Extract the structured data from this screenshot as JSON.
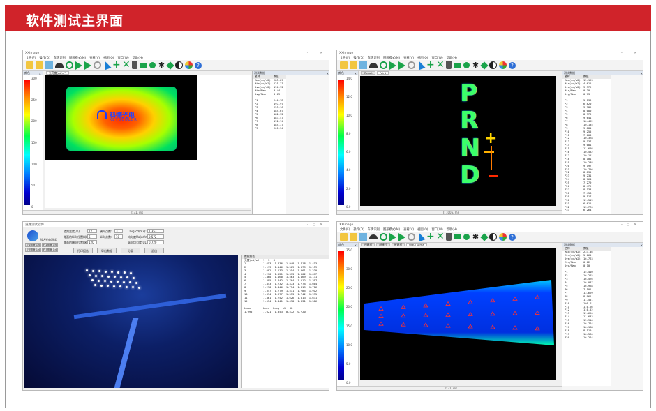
{
  "header": {
    "title": "软件测试主界面"
  },
  "app": {
    "menu": [
      "文件(F)",
      "操作(O)",
      "车牌识别",
      "图形模式(M)",
      "查看(V)",
      "视图(Q)",
      "窗口(W)",
      "帮助(H)"
    ]
  },
  "panel_left_header": "颜色",
  "panel_right_header": "测试数据",
  "tl": {
    "title": "XXImage",
    "tab": "光亮度(cd/m²)",
    "scale": [
      "300",
      "250",
      "200",
      "150",
      "100",
      "50",
      "0"
    ],
    "logo_text": "科德光电",
    "logo_sub": "KEYDCOLOR",
    "status": "T: 31, ms",
    "table_head": [
      "名称",
      "数值"
    ],
    "table_summary": [
      [
        "Max(cd/m2)",
        "285.87"
      ],
      [
        "Min(cd/m2)",
        "125.33"
      ],
      [
        "Ave(cd/m2)",
        "196.92"
      ],
      [
        "Min/Max",
        "0.44"
      ],
      [
        "Avg/Max",
        "0.69"
      ]
    ],
    "table_points": [
      [
        "P1",
        "246.78"
      ],
      [
        "P2",
        "197.97"
      ],
      [
        "P3",
        "255.16"
      ],
      [
        "P4",
        "185.67"
      ],
      [
        "P5",
        "182.32"
      ],
      [
        "P6",
        "183.47"
      ],
      [
        "P7",
        "192.74"
      ],
      [
        "P8",
        "185.37"
      ],
      [
        "P9",
        "201.34"
      ]
    ]
  },
  "tr": {
    "title": "XXImage",
    "tabs": [
      "Result",
      "Point"
    ],
    "scale": [
      "14.0",
      "12.0",
      "10.0",
      "8.0",
      "6.0",
      "4.0",
      "2.0",
      "0.0"
    ],
    "gear_letters": [
      "P",
      "R",
      "N",
      "D"
    ],
    "status": "T: 1005, ms",
    "table_head": [
      "名称",
      "数值"
    ],
    "table_summary": [
      [
        "Max(cd/m2)",
        "15.123"
      ],
      [
        "Min(cd/m2)",
        "4.612"
      ],
      [
        "Ave(cd/m2)",
        "9.372"
      ],
      [
        "Min/Max",
        "0.30"
      ],
      [
        "Avg/Max",
        "0.73"
      ]
    ],
    "table_points": [
      [
        "P1",
        "5.139"
      ],
      [
        "P2",
        "6.820"
      ],
      [
        "P3",
        "9.982"
      ],
      [
        "P4",
        "8.080"
      ],
      [
        "P5",
        "8.979"
      ],
      [
        "P6",
        "9.641"
      ],
      [
        "P7",
        "10.492"
      ],
      [
        "P8",
        "10.135"
      ],
      [
        "P9",
        "9.881"
      ],
      [
        "P10",
        "9.255"
      ],
      [
        "P11",
        "7.600"
      ],
      [
        "P12",
        "10.378"
      ],
      [
        "P13",
        "9.137"
      ],
      [
        "P14",
        "9.081"
      ],
      [
        "P15",
        "11.608"
      ],
      [
        "P16",
        "10.582"
      ],
      [
        "P17",
        "10.151"
      ],
      [
        "P18",
        "8.101"
      ],
      [
        "P19",
        "10.238"
      ],
      [
        "P20",
        "9.197"
      ],
      [
        "P21",
        "10.756"
      ],
      [
        "P22",
        "8.835"
      ],
      [
        "P23",
        "9.231"
      ],
      [
        "P24",
        "8.764"
      ],
      [
        "P25",
        "7.279"
      ],
      [
        "P26",
        "8.472"
      ],
      [
        "P27",
        "8.133"
      ],
      [
        "P28",
        "7.458"
      ],
      [
        "P29",
        "9.517"
      ],
      [
        "P30",
        "11.519"
      ],
      [
        "P31",
        "6.612"
      ],
      [
        "P32",
        "13.776"
      ],
      [
        "P33",
        "6.264"
      ]
    ]
  },
  "bl": {
    "title": "道路测试软件",
    "logo_caption": "科达光电测试",
    "left_buttons": [
      "左1照度 1:6",
      "右1照度 1:6",
      "左7照度 1:6",
      "右7照度 1:6"
    ],
    "fields": [
      {
        "label": "道路宽度(米):",
        "value": "12"
      },
      {
        "label": "路面的纵向位置(米):",
        "value": "6"
      },
      {
        "label": "路面的横向位置(米):",
        "value": "120"
      }
    ],
    "fields2": [
      {
        "label": "横向点数:",
        "value": "3"
      },
      {
        "label": "纵向点数:",
        "value": "10"
      }
    ],
    "fields3": [
      {
        "label": "Lavg(cd/m2):",
        "value": "1.353"
      },
      {
        "label": "均匀度Uo(cd/m2):",
        "value": "0.572"
      },
      {
        "label": "纵向均匀度(UL):",
        "value": "0.720"
      }
    ],
    "buttons": [
      "打印报告",
      "导出数据",
      "分屏",
      "退出"
    ],
    "table_title": "数据报告",
    "table_head": [
      "亮度(cd/m2)",
      "1",
      "2",
      "3"
    ],
    "table_rows": [
      [
        "1",
        "1.653",
        "1.436",
        "1.948",
        "1.718",
        "1.413"
      ],
      [
        "2",
        "1.119",
        "1.146",
        "1.509",
        "1.079",
        "1.159"
      ],
      [
        "3",
        "1.082",
        "1.133",
        "1.254",
        "1.061",
        "1.230"
      ],
      [
        "4",
        "1.270",
        "1.021",
        "1.313",
        "1.002",
        "1.077"
      ],
      [
        "5",
        "1.460",
        "1.160",
        "1.563",
        "1.469",
        "1.131"
      ],
      [
        "6",
        "1.395",
        "1.442",
        "1.704",
        "1.512",
        "1.397"
      ],
      [
        "7",
        "1.443",
        "1.732",
        "1.473",
        "1.774",
        "1.604"
      ],
      [
        "8",
        "1.290",
        "1.446",
        "1.754",
        "1.319",
        "1.716"
      ],
      [
        "9",
        "1.347",
        "1.779",
        "1.511",
        "1.785",
        "1.912"
      ],
      [
        "10",
        "1.394",
        "1.677",
        "1.553",
        "1.742",
        "1.995"
      ],
      [
        "11",
        "1.461",
        "1.752",
        "1.626",
        "1.513",
        "1.631"
      ],
      [
        "12",
        "1.554",
        "1.441",
        "1.698",
        "1.331",
        "1.586"
      ]
    ],
    "summary_head": [
      "Lmax",
      "Lmin",
      "Lavg",
      "U0",
      "UL"
    ],
    "summary_vals": [
      "1.995",
      "1.021",
      "1.353",
      "0.572",
      "0.720"
    ]
  },
  "br": {
    "title": "XXImage",
    "tabs": [
      "所建打",
      "所建打",
      "所建打",
      "Ortul Koma"
    ],
    "scale": [
      "35.0",
      "30.0",
      "25.0",
      "20.0",
      "15.0",
      "10.0",
      "5.0",
      "0.0"
    ],
    "status": "T: 31, ms",
    "table_head": [
      "名称",
      "数值"
    ],
    "table_summary": [
      [
        "Max(cd/m2)",
        "233.46"
      ],
      [
        "Min(cd/m2)",
        "5.665"
      ],
      [
        "Ave(cd/m2)",
        "16.763"
      ],
      [
        "Min/Max",
        "0.02"
      ],
      [
        "Avg/Max",
        "0.10"
      ]
    ],
    "table_points": [
      [
        "P1",
        "15.410"
      ],
      [
        "P2",
        "16.202"
      ],
      [
        "P3",
        "16.576"
      ],
      [
        "P4",
        "16.087"
      ],
      [
        "P5",
        "16.928"
      ],
      [
        "P6",
        "7.501"
      ],
      [
        "P7",
        "13.669"
      ],
      [
        "P8",
        "8.961"
      ],
      [
        "P9",
        "11.551"
      ],
      [
        "P10",
        "109.61"
      ],
      [
        "P11",
        "110.66"
      ],
      [
        "P12",
        "110.52"
      ],
      [
        "P13",
        "11.620"
      ],
      [
        "P14",
        "11.633"
      ],
      [
        "P15",
        "15.916"
      ],
      [
        "P16",
        "16.764"
      ],
      [
        "P17",
        "16.168"
      ],
      [
        "P18",
        "8.510"
      ],
      [
        "P19",
        "16.560"
      ],
      [
        "P20",
        "16.264"
      ]
    ]
  }
}
